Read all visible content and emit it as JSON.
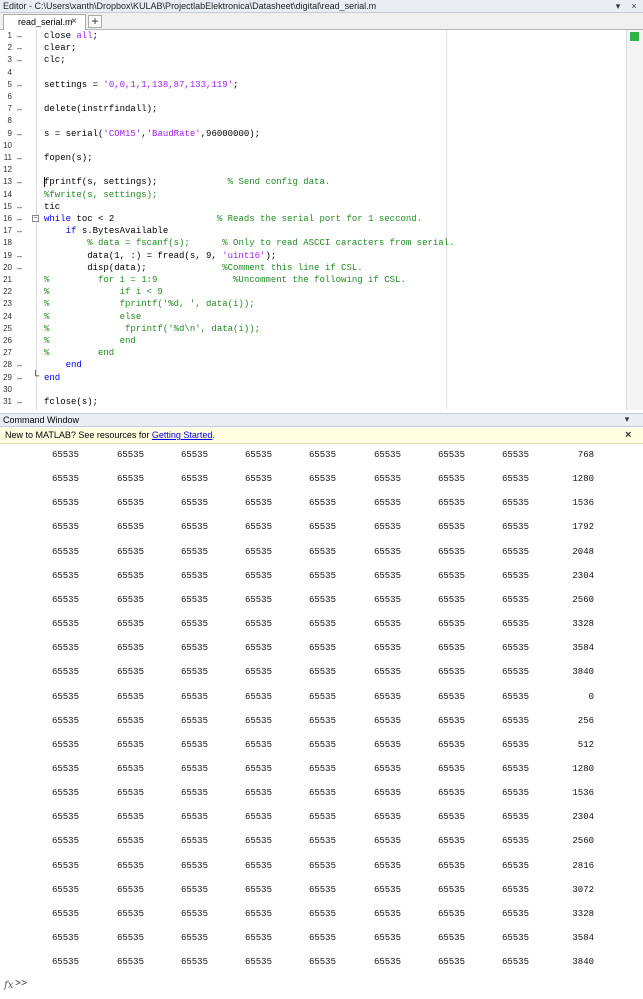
{
  "editor": {
    "title": "Editor - C:\\Users\\xanth\\Dropbox\\KULAB\\ProjectlabElektronica\\Datasheet\\digital\\read_serial.m",
    "tab_label": "read_serial.m",
    "tab_close": "×",
    "add_tab": "+",
    "dropdown": "▾",
    "close": "×",
    "lines": [
      {
        "n": "1",
        "dash": "–",
        "fold": "",
        "segs": [
          {
            "t": "close ",
            "c": ""
          },
          {
            "t": "all",
            "c": "str"
          },
          {
            "t": ";",
            "c": ""
          }
        ]
      },
      {
        "n": "2",
        "dash": "–",
        "fold": "",
        "segs": [
          {
            "t": "clear;",
            "c": ""
          }
        ]
      },
      {
        "n": "3",
        "dash": "–",
        "fold": "",
        "segs": [
          {
            "t": "clc;",
            "c": ""
          }
        ]
      },
      {
        "n": "4",
        "dash": "",
        "fold": "",
        "segs": []
      },
      {
        "n": "5",
        "dash": "–",
        "fold": "",
        "segs": [
          {
            "t": "settings = ",
            "c": ""
          },
          {
            "t": "'0,0,1,1,138,87,133,119'",
            "c": "str"
          },
          {
            "t": ";",
            "c": ""
          }
        ]
      },
      {
        "n": "6",
        "dash": "",
        "fold": "",
        "segs": []
      },
      {
        "n": "7",
        "dash": "–",
        "fold": "",
        "segs": [
          {
            "t": "delete(instrfindall);",
            "c": ""
          }
        ]
      },
      {
        "n": "8",
        "dash": "",
        "fold": "",
        "segs": []
      },
      {
        "n": "9",
        "dash": "–",
        "fold": "",
        "segs": [
          {
            "t": "s = serial(",
            "c": ""
          },
          {
            "t": "'COM15'",
            "c": "str"
          },
          {
            "t": ",",
            "c": ""
          },
          {
            "t": "'BaudRate'",
            "c": "str"
          },
          {
            "t": ",96000000);",
            "c": ""
          }
        ]
      },
      {
        "n": "10",
        "dash": "",
        "fold": "",
        "segs": []
      },
      {
        "n": "11",
        "dash": "–",
        "fold": "",
        "segs": [
          {
            "t": "fopen(s);",
            "c": ""
          }
        ]
      },
      {
        "n": "12",
        "dash": "",
        "fold": "",
        "segs": []
      },
      {
        "n": "13",
        "dash": "–",
        "fold": "",
        "segs": [
          {
            "t": "fprintf(s, settings);             ",
            "c": ""
          },
          {
            "t": "% Send config data.",
            "c": "cm"
          }
        ]
      },
      {
        "n": "14",
        "dash": "",
        "fold": "",
        "segs": [
          {
            "t": "%fwrite(s, settings);",
            "c": "cm"
          }
        ]
      },
      {
        "n": "15",
        "dash": "–",
        "fold": "",
        "segs": [
          {
            "t": "tic",
            "c": ""
          }
        ]
      },
      {
        "n": "16",
        "dash": "–",
        "fold": "−",
        "segs": [
          {
            "t": "while",
            "c": "kw"
          },
          {
            "t": " toc < 2                   ",
            "c": ""
          },
          {
            "t": "% Reads the serial port for 1 seccond.",
            "c": "cm"
          }
        ]
      },
      {
        "n": "17",
        "dash": "–",
        "fold": "",
        "segs": [
          {
            "t": "    ",
            "c": ""
          },
          {
            "t": "if",
            "c": "kw"
          },
          {
            "t": " s.BytesAvailable",
            "c": ""
          }
        ]
      },
      {
        "n": "18",
        "dash": "",
        "fold": "",
        "segs": [
          {
            "t": "        ",
            "c": ""
          },
          {
            "t": "% data = fscanf(s);      % Only to read ASCCI caracters from serial.",
            "c": "cm"
          }
        ]
      },
      {
        "n": "19",
        "dash": "–",
        "fold": "",
        "segs": [
          {
            "t": "        data(1, :) = fread(s, 9, ",
            "c": ""
          },
          {
            "t": "'uint16'",
            "c": "str"
          },
          {
            "t": ");",
            "c": ""
          }
        ]
      },
      {
        "n": "20",
        "dash": "–",
        "fold": "",
        "segs": [
          {
            "t": "        disp(data);              ",
            "c": ""
          },
          {
            "t": "%Comment this line if CSL.",
            "c": "cm"
          }
        ]
      },
      {
        "n": "21",
        "dash": "",
        "fold": "",
        "segs": [
          {
            "t": "%         for i = 1:9              %Uncomment the following if CSL.",
            "c": "cm"
          }
        ]
      },
      {
        "n": "22",
        "dash": "",
        "fold": "",
        "segs": [
          {
            "t": "%             if i < 9",
            "c": "cm"
          }
        ]
      },
      {
        "n": "23",
        "dash": "",
        "fold": "",
        "segs": [
          {
            "t": "%             fprintf('%d, ', data(i));",
            "c": "cm"
          }
        ]
      },
      {
        "n": "24",
        "dash": "",
        "fold": "",
        "segs": [
          {
            "t": "%             else",
            "c": "cm"
          }
        ]
      },
      {
        "n": "25",
        "dash": "",
        "fold": "",
        "segs": [
          {
            "t": "%              fprintf('%d\\n', data(i));",
            "c": "cm"
          }
        ]
      },
      {
        "n": "26",
        "dash": "",
        "fold": "",
        "segs": [
          {
            "t": "%             end",
            "c": "cm"
          }
        ]
      },
      {
        "n": "27",
        "dash": "",
        "fold": "",
        "segs": [
          {
            "t": "%         end",
            "c": "cm"
          }
        ]
      },
      {
        "n": "28",
        "dash": "–",
        "fold": "",
        "segs": [
          {
            "t": "    ",
            "c": ""
          },
          {
            "t": "end",
            "c": "kw"
          }
        ]
      },
      {
        "n": "29",
        "dash": "–",
        "fold": "└",
        "segs": [
          {
            "t": "end",
            "c": "kw"
          }
        ]
      },
      {
        "n": "30",
        "dash": "",
        "fold": "",
        "segs": []
      },
      {
        "n": "31",
        "dash": "–",
        "fold": "",
        "segs": [
          {
            "t": "fclose(s);",
            "c": ""
          }
        ]
      }
    ]
  },
  "command_window": {
    "title": "Command Window",
    "dropdown": "▾",
    "banner_text": "New to MATLAB? See resources for ",
    "banner_link": "Getting Started",
    "banner_end": ".",
    "banner_close": "×",
    "prompt_icon": "fx",
    "prompt": ">>",
    "rows": [
      [
        "65535",
        "65535",
        "65535",
        "65535",
        "65535",
        "65535",
        "65535",
        "65535",
        "768"
      ],
      [
        "65535",
        "65535",
        "65535",
        "65535",
        "65535",
        "65535",
        "65535",
        "65535",
        "1280"
      ],
      [
        "65535",
        "65535",
        "65535",
        "65535",
        "65535",
        "65535",
        "65535",
        "65535",
        "1536"
      ],
      [
        "65535",
        "65535",
        "65535",
        "65535",
        "65535",
        "65535",
        "65535",
        "65535",
        "1792"
      ],
      [
        "65535",
        "65535",
        "65535",
        "65535",
        "65535",
        "65535",
        "65535",
        "65535",
        "2048"
      ],
      [
        "65535",
        "65535",
        "65535",
        "65535",
        "65535",
        "65535",
        "65535",
        "65535",
        "2304"
      ],
      [
        "65535",
        "65535",
        "65535",
        "65535",
        "65535",
        "65535",
        "65535",
        "65535",
        "2560"
      ],
      [
        "65535",
        "65535",
        "65535",
        "65535",
        "65535",
        "65535",
        "65535",
        "65535",
        "3328"
      ],
      [
        "65535",
        "65535",
        "65535",
        "65535",
        "65535",
        "65535",
        "65535",
        "65535",
        "3584"
      ],
      [
        "65535",
        "65535",
        "65535",
        "65535",
        "65535",
        "65535",
        "65535",
        "65535",
        "3840"
      ],
      [
        "65535",
        "65535",
        "65535",
        "65535",
        "65535",
        "65535",
        "65535",
        "65535",
        "0"
      ],
      [
        "65535",
        "65535",
        "65535",
        "65535",
        "65535",
        "65535",
        "65535",
        "65535",
        "256"
      ],
      [
        "65535",
        "65535",
        "65535",
        "65535",
        "65535",
        "65535",
        "65535",
        "65535",
        "512"
      ],
      [
        "65535",
        "65535",
        "65535",
        "65535",
        "65535",
        "65535",
        "65535",
        "65535",
        "1280"
      ],
      [
        "65535",
        "65535",
        "65535",
        "65535",
        "65535",
        "65535",
        "65535",
        "65535",
        "1536"
      ],
      [
        "65535",
        "65535",
        "65535",
        "65535",
        "65535",
        "65535",
        "65535",
        "65535",
        "2304"
      ],
      [
        "65535",
        "65535",
        "65535",
        "65535",
        "65535",
        "65535",
        "65535",
        "65535",
        "2560"
      ],
      [
        "65535",
        "65535",
        "65535",
        "65535",
        "65535",
        "65535",
        "65535",
        "65535",
        "2816"
      ],
      [
        "65535",
        "65535",
        "65535",
        "65535",
        "65535",
        "65535",
        "65535",
        "65535",
        "3072"
      ],
      [
        "65535",
        "65535",
        "65535",
        "65535",
        "65535",
        "65535",
        "65535",
        "65535",
        "3328"
      ],
      [
        "65535",
        "65535",
        "65535",
        "65535",
        "65535",
        "65535",
        "65535",
        "65535",
        "3584"
      ],
      [
        "65535",
        "65535",
        "65535",
        "65535",
        "65535",
        "65535",
        "65535",
        "65535",
        "3840"
      ]
    ]
  }
}
